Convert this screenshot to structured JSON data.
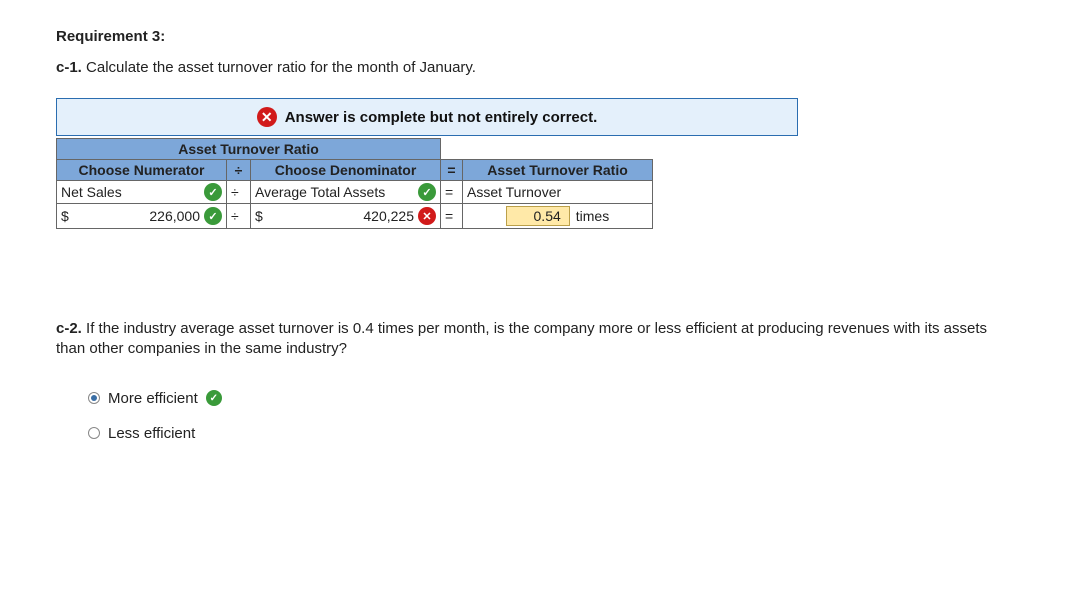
{
  "requirement_label": "Requirement 3:",
  "c1": {
    "label": "c-1.",
    "prompt": "Calculate the asset turnover ratio for the month of January."
  },
  "status": "Answer is complete but not entirely correct.",
  "table": {
    "title": "Asset Turnover Ratio",
    "header": {
      "numerator": "Choose Numerator",
      "divide": "÷",
      "denominator": "Choose Denominator",
      "equals": "=",
      "result": "Asset Turnover Ratio"
    },
    "row_desc": {
      "numerator": "Net Sales",
      "divide": "÷",
      "denominator": "Average Total Assets",
      "equals": "=",
      "result": "Asset Turnover"
    },
    "row_val": {
      "num_sym": "$",
      "num_val": "226,000",
      "divide": "÷",
      "den_sym": "$",
      "den_val": "420,225",
      "equals": "=",
      "res_val": "0.54",
      "res_unit": "times"
    }
  },
  "c2": {
    "label": "c-2.",
    "prompt": "If the industry average asset turnover is 0.4 times per month, is the company more or less efficient at producing revenues with its assets than other companies in the same industry?",
    "options": {
      "more": "More efficient",
      "less": "Less efficient"
    },
    "selected": "more"
  }
}
